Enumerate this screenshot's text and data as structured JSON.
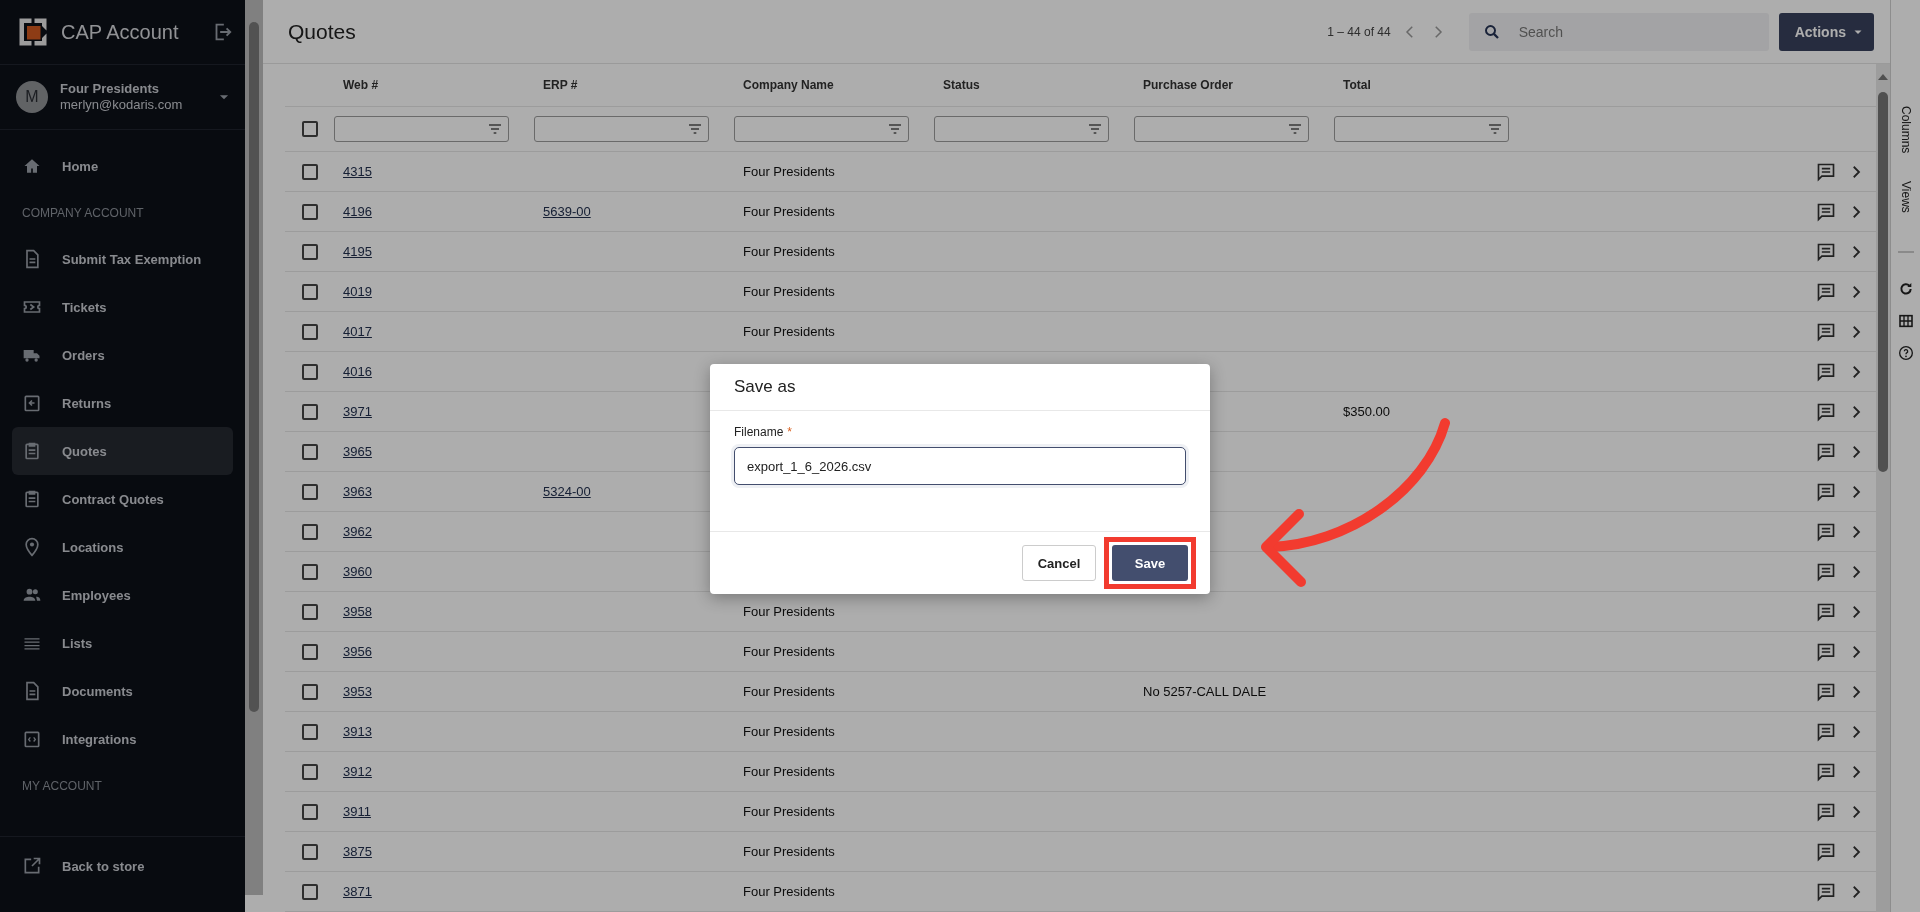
{
  "sidebar": {
    "brand": "CAP Account",
    "account": {
      "avatar": "M",
      "name": "Four Presidents",
      "email": "merlyn@kodaris.com"
    },
    "items": [
      {
        "kind": "link",
        "label": "Home",
        "selected": false
      },
      {
        "kind": "section",
        "label": "COMPANY ACCOUNT"
      },
      {
        "kind": "link",
        "label": "Submit Tax Exemption",
        "selected": false
      },
      {
        "kind": "link",
        "label": "Tickets",
        "selected": false
      },
      {
        "kind": "link",
        "label": "Orders",
        "selected": false
      },
      {
        "kind": "link",
        "label": "Returns",
        "selected": false
      },
      {
        "kind": "link",
        "label": "Quotes",
        "selected": true
      },
      {
        "kind": "link",
        "label": "Contract Quotes",
        "selected": false
      },
      {
        "kind": "link",
        "label": "Locations",
        "selected": false
      },
      {
        "kind": "link",
        "label": "Employees",
        "selected": false
      },
      {
        "kind": "link",
        "label": "Lists",
        "selected": false
      },
      {
        "kind": "link",
        "label": "Documents",
        "selected": false
      },
      {
        "kind": "link",
        "label": "Integrations",
        "selected": false
      },
      {
        "kind": "section",
        "label": "MY ACCOUNT"
      }
    ],
    "footer_link": "Back to store"
  },
  "header": {
    "title": "Quotes",
    "pager": "1 – 44 of 44",
    "search": {
      "placeholder": "Search"
    },
    "actions": "Actions"
  },
  "table": {
    "columns": [
      "Web #",
      "ERP #",
      "Company Name",
      "Status",
      "Purchase Order",
      "Total"
    ],
    "select_all_checked": false,
    "rows": [
      {
        "web": "4315",
        "company": "Four Presidents",
        "checked": false
      },
      {
        "web": "4196",
        "erp": "5639-00",
        "company": "Four Presidents",
        "checked": false
      },
      {
        "web": "4195",
        "company": "Four Presidents",
        "checked": false
      },
      {
        "web": "4019",
        "company": "Four Presidents",
        "checked": false
      },
      {
        "web": "4017",
        "company": "Four Presidents",
        "checked": false
      },
      {
        "web": "4016",
        "checked": false
      },
      {
        "web": "3971",
        "total": "$350.00",
        "checked": false
      },
      {
        "web": "3965",
        "checked": false
      },
      {
        "web": "3963",
        "erp": "5324-00",
        "checked": false
      },
      {
        "web": "3962",
        "checked": false
      },
      {
        "web": "3960",
        "checked": false
      },
      {
        "web": "3958",
        "company": "Four Presidents",
        "checked": false
      },
      {
        "web": "3956",
        "company": "Four Presidents",
        "checked": false
      },
      {
        "web": "3953",
        "company": "Four Presidents",
        "po": "No 5257-CALL DALE",
        "checked": false
      },
      {
        "web": "3913",
        "company": "Four Presidents",
        "checked": false
      },
      {
        "web": "3912",
        "company": "Four Presidents",
        "checked": false
      },
      {
        "web": "3911",
        "company": "Four Presidents",
        "checked": false
      },
      {
        "web": "3875",
        "company": "Four Presidents",
        "checked": false
      },
      {
        "web": "3871",
        "company": "Four Presidents",
        "checked": false
      }
    ]
  },
  "side_rail": {
    "tabs": [
      "Columns",
      "Views"
    ]
  },
  "dialog": {
    "title": "Save as",
    "field_label": "Filename",
    "required_mark": "*",
    "value": "export_1_6_2026.csv",
    "cancel": "Cancel",
    "save": "Save",
    "save_highlighted": true
  }
}
